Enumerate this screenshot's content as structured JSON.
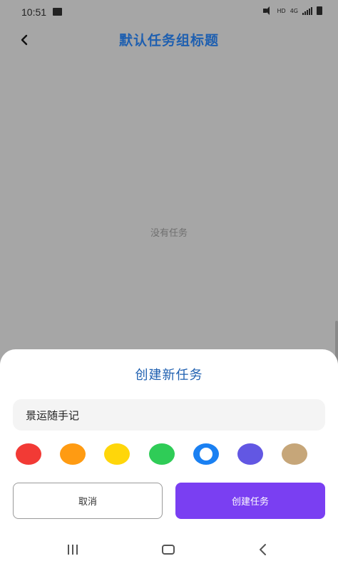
{
  "status_bar": {
    "time": "10:51",
    "network_hd": "HD",
    "network_4g": "4G"
  },
  "header": {
    "title": "默认任务组标题"
  },
  "main": {
    "empty_text": "没有任务"
  },
  "dialog": {
    "title": "创建新任务",
    "input_value": "景运随手记",
    "colors": [
      "#f23a35",
      "#ff9b12",
      "#ffd60a",
      "#2fcc57",
      "#1a80f2",
      "#6257e3",
      "#c6a679"
    ],
    "selected_color_index": 4,
    "cancel_label": "取消",
    "confirm_label": "创建任务"
  },
  "icons": {
    "back": "chevron-left-icon",
    "photo": "image-icon",
    "mute": "mute-icon",
    "signal": "signal-icon",
    "battery": "battery-icon",
    "nav_recents": "recents-icon",
    "nav_home": "home-icon",
    "nav_back": "back-icon"
  }
}
